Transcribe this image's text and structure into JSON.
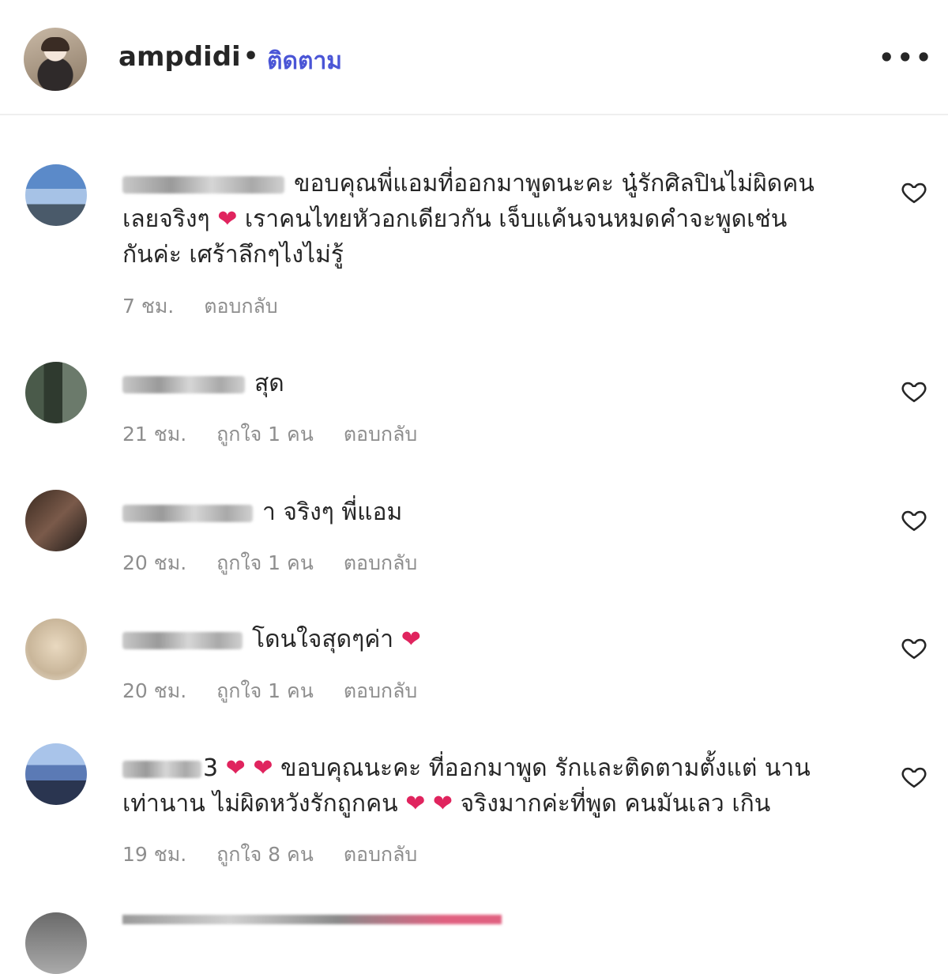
{
  "header": {
    "username": "ampdidi",
    "separator": "•",
    "follow_label": "ติดตาม",
    "more_label": "•••"
  },
  "comments": [
    {
      "text_line1": "ขอบคุณพี่แอมที่ออกมาพูดนะคะ นู๋รักศิลปินไม่ผิดคน",
      "text_line2": "เลยจริงๆ",
      "heart": "❤",
      "text_line2b": "เราคนไทยหัวอกเดียวกัน เจ็บแค้นจนหมดคำจะพูดเช่น",
      "text_line3": "กันค่ะ เศร้าลึกๆไงไม่รู้",
      "time": "7 ชม.",
      "reply": "ตอบกลับ"
    },
    {
      "text": "สุด",
      "time": "21 ชม.",
      "likes": "ถูกใจ 1 คน",
      "reply": "ตอบกลับ"
    },
    {
      "text": "า จริงๆ พี่แอม",
      "time": "20 ชม.",
      "likes": "ถูกใจ 1 คน",
      "reply": "ตอบกลับ"
    },
    {
      "text": "โดนใจสุดๆค่า",
      "heart": "❤",
      "time": "20 ชม.",
      "likes": "ถูกใจ 1 คน",
      "reply": "ตอบกลับ"
    },
    {
      "prefix": "3",
      "hearts": "❤ ❤",
      "text_line1": "ขอบคุณนะคะ ที่ออกมาพูด รักและติดตามตั้งแต่ นาน",
      "text_line2a": "เท่านาน ไม่ผิดหวังรักถูกคน",
      "hearts2": "❤ ❤",
      "text_line2b": "จริงมากค่ะที่พูด คนมันเลว เกิน",
      "time": "19 ชม.",
      "likes": "ถูกใจ 8 คน",
      "reply": "ตอบกลับ"
    }
  ],
  "colors": {
    "follow": "#4a55d6",
    "heart": "#e0245e",
    "meta": "#8e8e8e"
  },
  "icons": [
    "more-options-icon",
    "like-heart-icon"
  ]
}
